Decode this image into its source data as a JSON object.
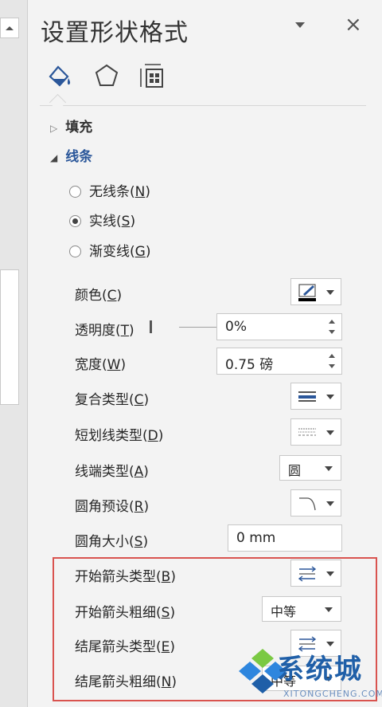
{
  "pane": {
    "title": "设置形状格式",
    "close": "×"
  },
  "tabs": [
    {
      "name": "fill-line-icon"
    },
    {
      "name": "effects-icon"
    },
    {
      "name": "size-properties-icon"
    }
  ],
  "sections": {
    "fill": {
      "label": "填充"
    },
    "line": {
      "label": "线条"
    }
  },
  "line_type": {
    "options": [
      {
        "label": "无线条",
        "key": "N",
        "selected": false
      },
      {
        "label": "实线",
        "key": "S",
        "selected": true
      },
      {
        "label": "渐变线",
        "key": "G",
        "selected": false
      }
    ]
  },
  "props": {
    "color": {
      "label": "颜色",
      "key": "C"
    },
    "transparency": {
      "label": "透明度",
      "key": "T",
      "value": "0%"
    },
    "width": {
      "label": "宽度",
      "key": "W",
      "value": "0.75 磅"
    },
    "compound": {
      "label": "复合类型",
      "key": "C"
    },
    "dash": {
      "label": "短划线类型",
      "key": "D"
    },
    "cap": {
      "label": "线端类型",
      "key": "A",
      "value": "圆"
    },
    "join": {
      "label": "圆角预设",
      "key": "R"
    },
    "join_size": {
      "label": "圆角大小",
      "key": "S",
      "value": "0 mm"
    },
    "begin_arrow_type": {
      "label": "开始箭头类型",
      "key": "B"
    },
    "begin_arrow_size": {
      "label": "开始箭头粗细",
      "key": "S",
      "value": "中等"
    },
    "end_arrow_type": {
      "label": "结尾箭头类型",
      "key": "E"
    },
    "end_arrow_size": {
      "label": "结尾箭头粗细",
      "key": "N",
      "value": "中等"
    }
  },
  "watermark": {
    "text": "系统城",
    "sub": "XITONGCHENG.COM"
  },
  "colors": {
    "accent": "#2b579a",
    "highlight": "#d9534f"
  }
}
